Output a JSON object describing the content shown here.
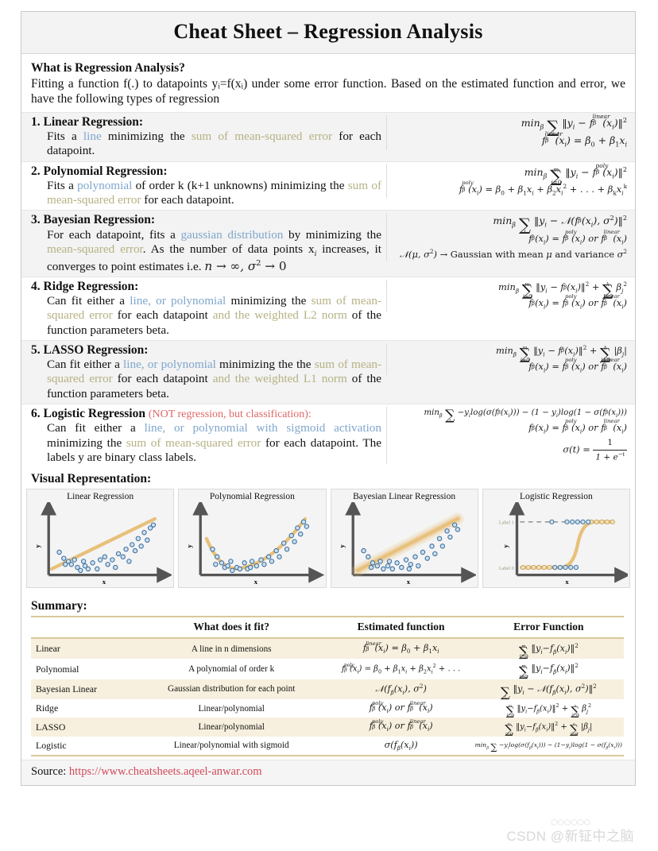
{
  "title": "Cheat Sheet – Regression Analysis",
  "intro": {
    "heading": "What is Regression Analysis?",
    "text": "Fitting a function f(.) to datapoints yᵢ=f(xᵢ) under some error function. Based on the estimated function and error, we have the following types of regression"
  },
  "sections": [
    {
      "num": "1.",
      "heading": "Linear Regression:",
      "body_parts": [
        {
          "t": "Fits a ",
          "c": "plain"
        },
        {
          "t": "line",
          "c": "fn"
        },
        {
          "t": " minimizing the ",
          "c": "plain"
        },
        {
          "t": "sum of mean-squared error",
          "c": "err"
        },
        {
          "t": " for each datapoint.",
          "c": "plain"
        }
      ],
      "eq1": "minβ ∑ᵢ ‖yᵢ − fβ^linear(xᵢ)‖²",
      "eq2": "fβ^linear(xᵢ) = β₀ + β₁xᵢ"
    },
    {
      "num": "2.",
      "heading": "Polynomial Regression:",
      "body_parts": [
        {
          "t": "Fits a ",
          "c": "plain"
        },
        {
          "t": "polynomial",
          "c": "fn"
        },
        {
          "t": " of order k (k+1 unknowns) minimizing the ",
          "c": "plain"
        },
        {
          "t": "sum of mean-squared error",
          "c": "err"
        },
        {
          "t": " for each datapoint.",
          "c": "plain"
        }
      ],
      "eq1": "minβ ∑(i=0..m) ‖yᵢ − fβ^poly(xᵢ)‖²",
      "eq2": "fβ^poly(xᵢ) = β₀ + β₁xᵢ + β₂xᵢ² + … + βₖxᵢ^k"
    },
    {
      "num": "3.",
      "heading": "Bayesian Regression:",
      "body_parts": [
        {
          "t": "For each datapoint, fits a ",
          "c": "plain"
        },
        {
          "t": "gaussian distribution",
          "c": "fn"
        },
        {
          "t": " by minimizing the ",
          "c": "plain"
        },
        {
          "t": "mean-squared error",
          "c": "err"
        },
        {
          "t": ". As the number of data points xᵢ increases, it converges to point estimates i.e. ",
          "c": "plain"
        },
        {
          "t": "n → ∞, σ² → 0",
          "c": "math"
        }
      ],
      "eq1": "minβ ∑ᵢ ‖yᵢ − 𝒩(fβ(xᵢ), σ²)‖²",
      "eq2": "fβ(xᵢ) = fβ^poly(xᵢ) or fβ^linear(xᵢ)",
      "eq3": "𝒩(μ, σ²) → Gaussian with mean μ and variance σ²"
    },
    {
      "num": "4.",
      "heading": "Ridge Regression:",
      "body_parts": [
        {
          "t": "Can fit either a ",
          "c": "plain"
        },
        {
          "t": "line, or polynomial",
          "c": "fn"
        },
        {
          "t": " minimizing the ",
          "c": "plain"
        },
        {
          "t": "sum of mean-squared error",
          "c": "err"
        },
        {
          "t": " for each datapoint ",
          "c": "plain"
        },
        {
          "t": "and the weighted L2 norm",
          "c": "err"
        },
        {
          "t": " of the function parameters beta.",
          "c": "plain"
        }
      ],
      "eq1": "minβ ∑(i=0..m) ‖yᵢ − fβ(xᵢ)‖² + ∑(j=0..k) βⱼ²",
      "eq2": "fβ(xᵢ) = fβ^poly(xᵢ) or fβ^linear(xᵢ)"
    },
    {
      "num": "5.",
      "heading": "LASSO Regression:",
      "body_parts": [
        {
          "t": "Can fit either a ",
          "c": "plain"
        },
        {
          "t": "line, or polynomial",
          "c": "fn"
        },
        {
          "t": " minimizing the the ",
          "c": "plain"
        },
        {
          "t": "sum of mean-squared error",
          "c": "err"
        },
        {
          "t": " for each datapoint ",
          "c": "plain"
        },
        {
          "t": "and the weighted L1 norm",
          "c": "err"
        },
        {
          "t": " of the function parameters beta.",
          "c": "plain"
        }
      ],
      "eq1": "minβ ∑(i=0..m) ‖yᵢ − fβ(xᵢ)‖² + ∑(j=0..k) |βⱼ|",
      "eq2": "fβ(xᵢ) = fβ^poly(xᵢ) or fβ^linear(xᵢ)"
    },
    {
      "num": "6.",
      "heading": "Logistic Regression",
      "heading_warn": "(NOT regression, but classification):",
      "body_parts": [
        {
          "t": "Can fit either a ",
          "c": "plain"
        },
        {
          "t": "line, or polynomial with sigmoid activation",
          "c": "fn"
        },
        {
          "t": " minimizing the ",
          "c": "plain"
        },
        {
          "t": "sum of mean-squared error",
          "c": "err"
        },
        {
          "t": " for each datapoint. The labels y are binary class labels.",
          "c": "plain"
        }
      ],
      "eq1": "minβ ∑ᵢ −yᵢ log(σ(fβ(xᵢ))) − (1 − yᵢ)log(1 − σ(fβ(xᵢ)))",
      "eq2": "fβ(xᵢ) = fβ^poly(xᵢ) or fβ^linear(xᵢ)",
      "eq3": "σ(t) = 1 / (1 + e⁻ᵗ)"
    }
  ],
  "visual": {
    "heading": "Visual Representation:",
    "axis_x": "x",
    "axis_y": "y",
    "charts": [
      {
        "title": "Linear Regression"
      },
      {
        "title": "Polynomial Regression"
      },
      {
        "title": "Bayesian Linear Regression"
      },
      {
        "title": "Logistic Regression",
        "label_hi": "Label 1",
        "label_lo": "Label 0"
      }
    ]
  },
  "summary": {
    "heading": "Summary:",
    "columns": [
      "",
      "What does it fit?",
      "Estimated function",
      "Error Function"
    ],
    "rows": [
      {
        "name": "Linear",
        "fit": "A line in n dimensions",
        "est": "fβ^linear(xᵢ) = β₀ + β₁xᵢ",
        "err": "∑(i=0..m) ‖yᵢ − fβ(xᵢ)‖²"
      },
      {
        "name": "Polynomial",
        "fit": "A polynomial of order k",
        "est": "fβ^poly(xᵢ) = β₀ + β₁xᵢ + β₂xᵢ² + …",
        "err": "∑(i=0..m) ‖yᵢ − fβ(xᵢ)‖²"
      },
      {
        "name": "Bayesian Linear",
        "fit": "Gaussian distribution for each point",
        "est": "𝒩(fβ(xᵢ), σ²)",
        "err": "∑ᵢ ‖yᵢ − 𝒩(fβ(xᵢ), σ²)‖²"
      },
      {
        "name": "Ridge",
        "fit": "Linear/polynomial",
        "est": "fβ^poly(xᵢ) or fβ^linear(xᵢ)",
        "err": "∑(i=0..m) ‖yᵢ − fβ(xᵢ)‖² + ∑(j=0..n) βⱼ²"
      },
      {
        "name": "LASSO",
        "fit": "Linear/polynomial",
        "est": "fβ^poly(xᵢ) or fβ^linear(xᵢ)",
        "err": "∑(i=0..m) ‖yᵢ − fβ(xᵢ)‖² + ∑(j=0..n) |βⱼ|"
      },
      {
        "name": "Logistic",
        "fit": "Linear/polynomial with sigmoid",
        "est": "σ(fβ(xᵢ))",
        "err": "minβ ∑ᵢ −yᵢ log(σ(fβ(xᵢ))) − (1 − yᵢ)log(1 − σ(fβ(xᵢ)))"
      }
    ]
  },
  "footer": {
    "source_label": "Source:",
    "source_url": "https://www.cheatsheets.aqeel-anwar.com"
  },
  "watermark": "CSDN @新钲中之脑",
  "colors": {
    "function_blue": "#7fa6cc",
    "error_olive": "#b5b183",
    "warn_red": "#e06666",
    "url_red": "#d04a5a",
    "curve_tan": "#e8c07a",
    "dot_blue": "#3a6f9f",
    "table_rule": "#d9c89a",
    "table_stripe": "#f7f0de"
  }
}
